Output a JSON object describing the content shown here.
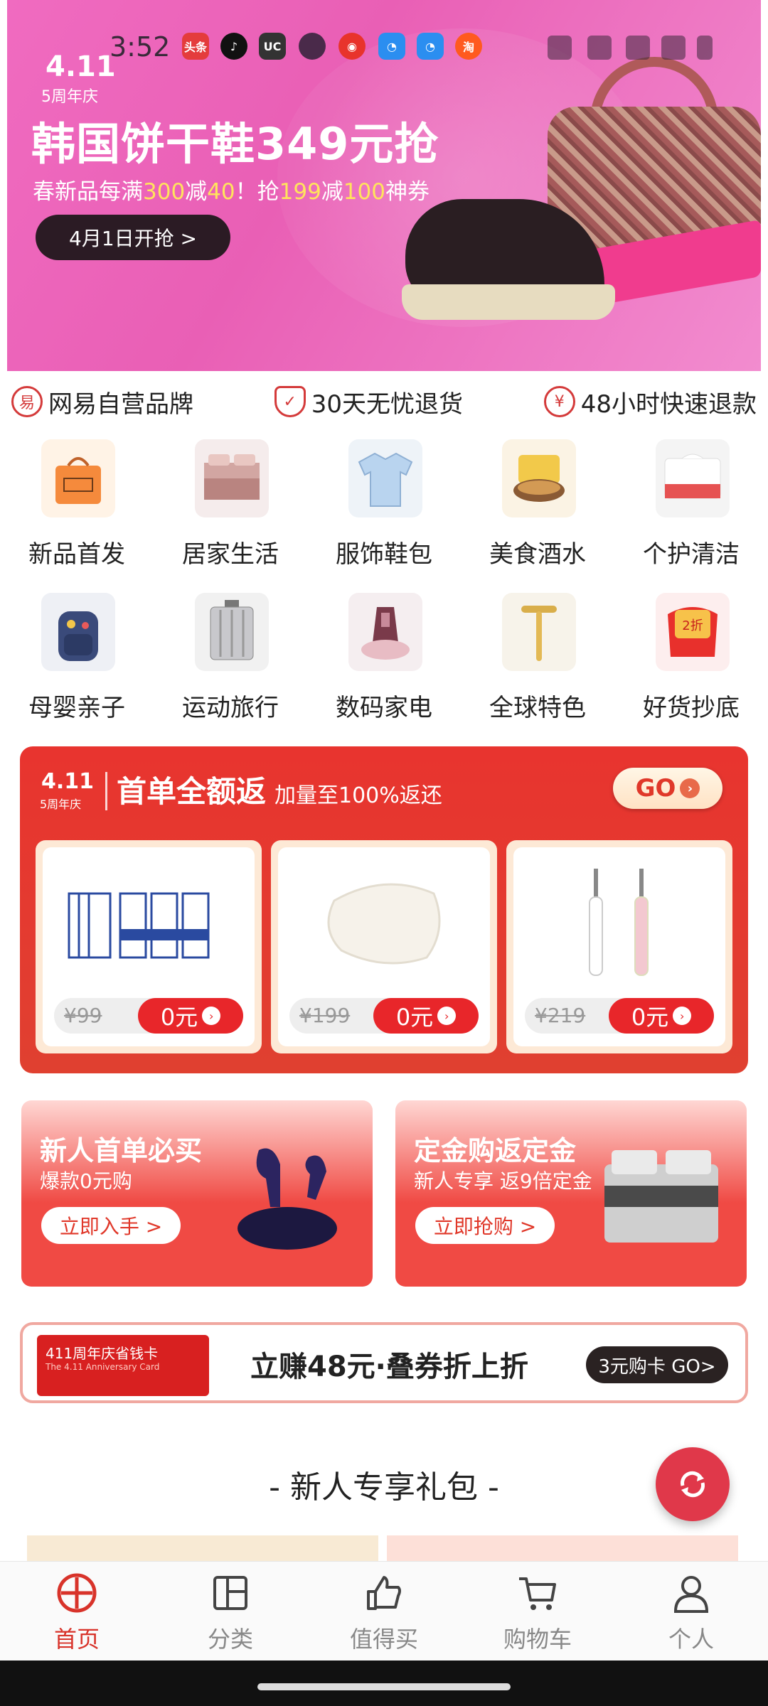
{
  "status_bar": {
    "time": "3:52",
    "apps": [
      {
        "name": "toutiao",
        "label": "头条",
        "color": "#e43c3c"
      },
      {
        "name": "douyin",
        "label": "♪",
        "color": "#111111"
      },
      {
        "name": "uc",
        "label": "UC",
        "color": "#333333"
      },
      {
        "name": "app-dark",
        "label": "",
        "color": "#4a2a4a"
      },
      {
        "name": "netease-music",
        "label": "◉",
        "color": "#e8332c"
      },
      {
        "name": "browser-1",
        "label": "◔",
        "color": "#2b8ef0"
      },
      {
        "name": "browser-2",
        "label": "◔",
        "color": "#2b8ef0"
      },
      {
        "name": "taobao",
        "label": "淘",
        "color": "#ff5a1f"
      }
    ]
  },
  "banner": {
    "badge_main": "4.11",
    "badge_sub": "5周年庆",
    "title": "韩国饼干鞋349元抢",
    "subtitle_parts": [
      "春新品每满",
      "300",
      "减",
      "40",
      "！抢",
      "199",
      "减",
      "100",
      "神券"
    ],
    "cta": "4月1日开抢 >"
  },
  "guarantees": [
    {
      "icon": "netease-logo-icon",
      "glyph": "易",
      "label": "网易自营品牌"
    },
    {
      "icon": "shield-check-icon",
      "glyph": "✓",
      "label": "30天无忧退货"
    },
    {
      "icon": "yuan-icon",
      "glyph": "¥",
      "label": "48小时快速退款"
    }
  ],
  "categories": [
    {
      "label": "新品首发",
      "icon": "new-bag-icon"
    },
    {
      "label": "居家生活",
      "icon": "bedding-icon"
    },
    {
      "label": "服饰鞋包",
      "icon": "shirt-icon"
    },
    {
      "label": "美食酒水",
      "icon": "noodle-bowl-icon"
    },
    {
      "label": "个护清洁",
      "icon": "tissue-icon"
    },
    {
      "label": "母婴亲子",
      "icon": "backpack-icon"
    },
    {
      "label": "运动旅行",
      "icon": "suitcase-icon"
    },
    {
      "label": "数码家电",
      "icon": "vacuum-icon"
    },
    {
      "label": "全球特色",
      "icon": "beauty-roller-icon"
    },
    {
      "label": "好货抄底",
      "icon": "discount-tag-icon"
    }
  ],
  "promo": {
    "badge_main": "4.11",
    "badge_sub": "5周年庆",
    "title": "首单全额返",
    "subtitle": "加量至100%返还",
    "go": "GO",
    "products": [
      {
        "old_price": "¥99",
        "price": "0元",
        "icon": "milk-icon"
      },
      {
        "old_price": "¥199",
        "price": "0元",
        "icon": "pillow-icon"
      },
      {
        "old_price": "¥219",
        "price": "0元",
        "icon": "toothbrush-icon"
      }
    ]
  },
  "cards": [
    {
      "title": "新人首单必买",
      "subtitle": "爆款0元购",
      "button": "立即入手 >",
      "icon": "earbuds-icon"
    },
    {
      "title": "定金购返定金",
      "subtitle": "新人专享 返9倍定金",
      "button": "立即抢购 >",
      "icon": "bed-icon"
    }
  ],
  "savings": {
    "card_title": "411周年庆省钱卡",
    "card_sub": "The 4.11 Anniversary Card",
    "text": "立赚48元·叠券折上折",
    "button": "3元购卡 GO>"
  },
  "section": {
    "title": "- 新人专享礼包 -"
  },
  "nav": [
    {
      "label": "首页",
      "icon": "home-icon",
      "active": true
    },
    {
      "label": "分类",
      "icon": "category-icon",
      "active": false
    },
    {
      "label": "值得买",
      "icon": "thumbs-up-icon",
      "active": false
    },
    {
      "label": "购物车",
      "icon": "cart-icon",
      "active": false
    },
    {
      "label": "个人",
      "icon": "person-icon",
      "active": false
    }
  ],
  "colors": {
    "accent": "#d8332a",
    "banner_pink": "#e95fb5"
  }
}
